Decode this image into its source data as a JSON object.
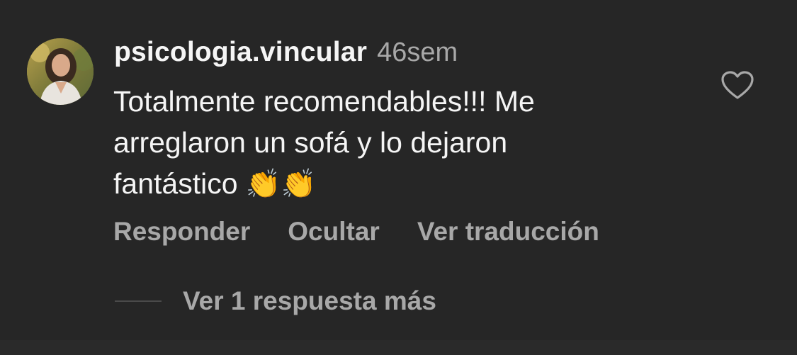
{
  "comment": {
    "username": "psicologia.vincular",
    "time_ago": "46sem",
    "text_lines": [
      "Totalmente recomendables!!! Me",
      "arreglaron un sofá y lo dejaron",
      "fantástico"
    ],
    "emojis": [
      "👏",
      "👏"
    ],
    "like_icon": "heart-outline-icon",
    "avatar_icon": "profile-photo"
  },
  "actions": {
    "reply": "Responder",
    "hide": "Ocultar",
    "translate": "Ver traducción"
  },
  "replies": {
    "label": "Ver 1 respuesta más"
  },
  "colors": {
    "background": "#262626",
    "primary_text": "#f5f5f5",
    "secondary_text": "#a8a8a8"
  }
}
